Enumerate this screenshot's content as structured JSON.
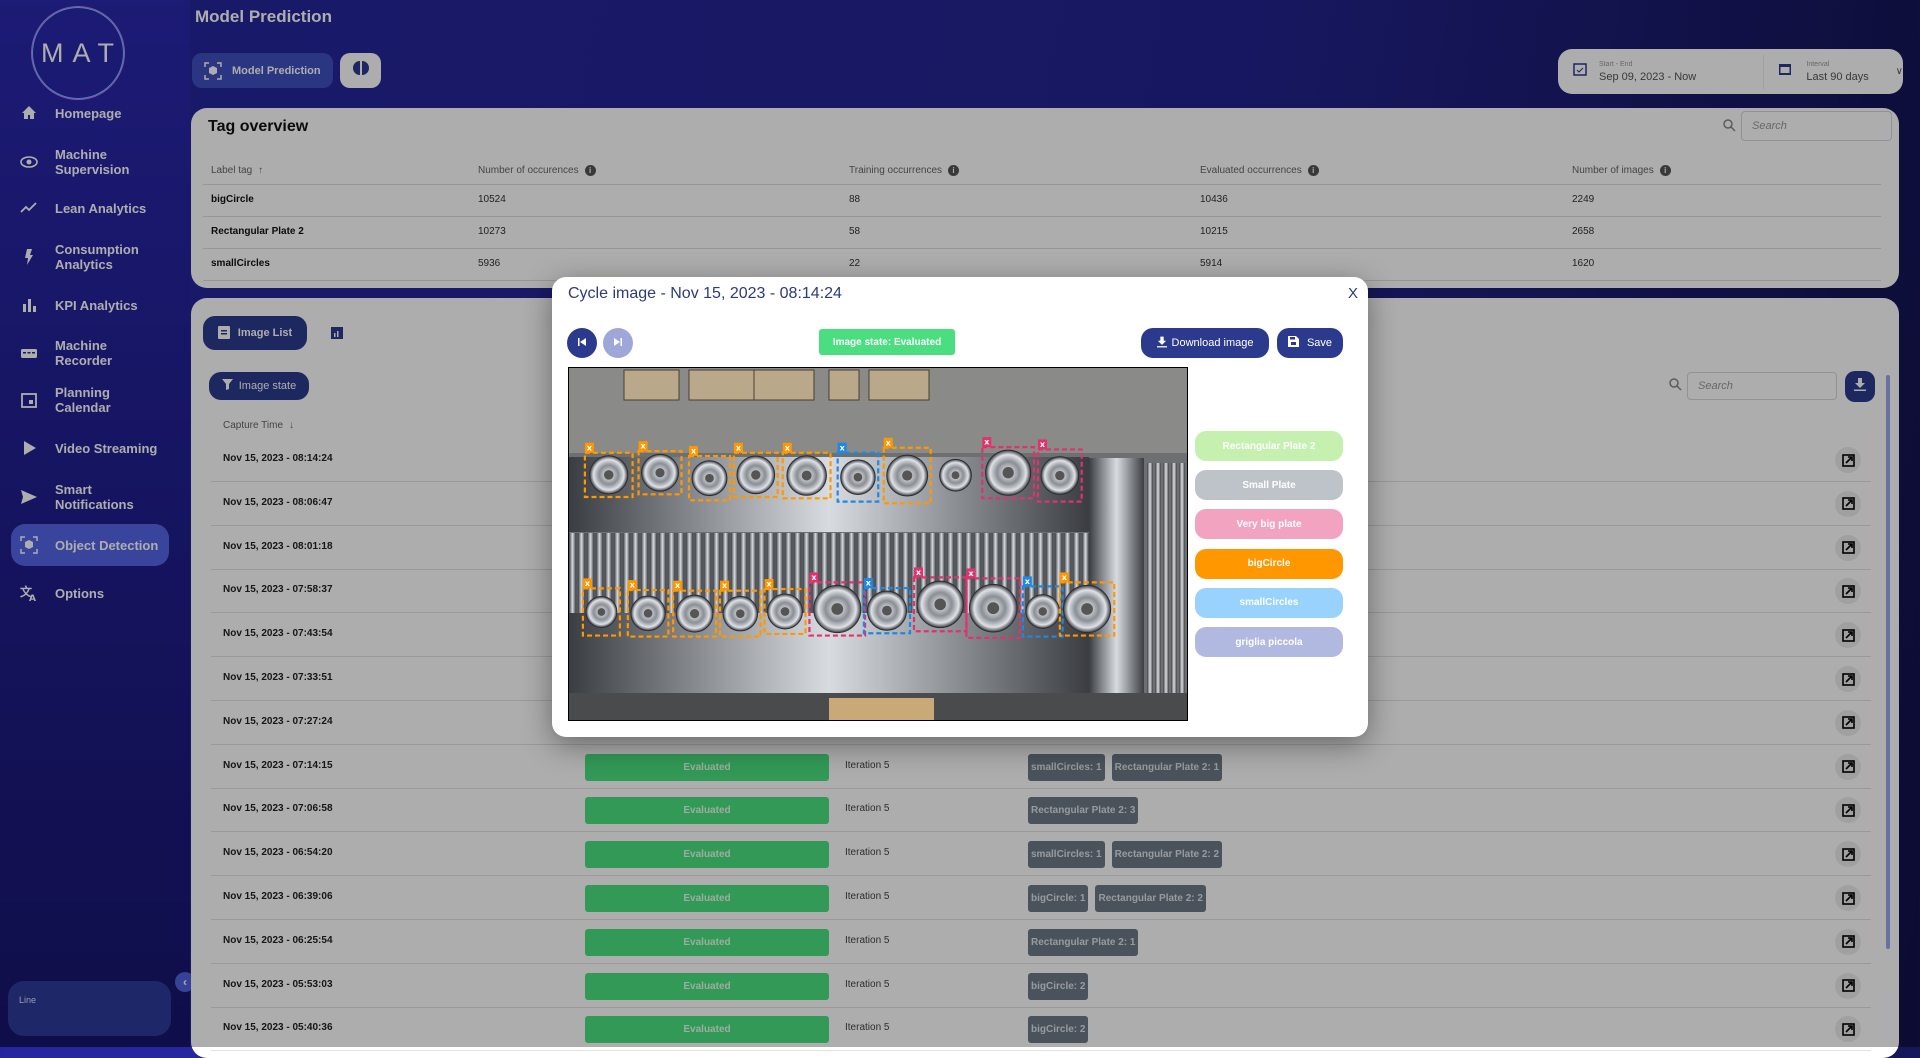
{
  "sidebar": {
    "logo": "MAT",
    "items": [
      {
        "label": "Homepage",
        "icon": "home-icon"
      },
      {
        "label": "Machine Supervision",
        "icon": "eye-icon"
      },
      {
        "label": "Lean Analytics",
        "icon": "trend-icon"
      },
      {
        "label": "Consumption Analytics",
        "icon": "bolt-icon"
      },
      {
        "label": "KPI Analytics",
        "icon": "bar-chart-icon"
      },
      {
        "label": "Machine Recorder",
        "icon": "recorder-icon"
      },
      {
        "label": "Planning Calendar",
        "icon": "calendar-icon"
      },
      {
        "label": "Video Streaming",
        "icon": "play-icon"
      },
      {
        "label": "Smart Notifications",
        "icon": "send-icon"
      },
      {
        "label": "Object Detection",
        "icon": "object-detection-icon",
        "active": true
      },
      {
        "label": "Options",
        "icon": "translate-icon"
      }
    ],
    "line_label": "Line"
  },
  "header": {
    "title": "Model Prediction",
    "tab_model_prediction": "Model Prediction",
    "date": {
      "start_end_label": "Start - End",
      "start_end_value": "Sep 09, 2023 - Now",
      "interval_label": "Interval",
      "interval_value": "Last 90 days"
    }
  },
  "tag_overview": {
    "title": "Tag overview",
    "search_placeholder": "Search",
    "columns": [
      "Label tag",
      "Number of occurences",
      "Training occurrences",
      "Evaluated occurrences",
      "Number of images"
    ],
    "rows": [
      [
        "bigCircle",
        "10524",
        "88",
        "10436",
        "2249"
      ],
      [
        "Rectangular Plate 2",
        "10273",
        "58",
        "10215",
        "2658"
      ],
      [
        "smallCircles",
        "5936",
        "22",
        "5914",
        "1620"
      ]
    ]
  },
  "image_list": {
    "tab_label": "Image List",
    "filter_label": "Image state",
    "search_placeholder": "Search",
    "column_capture_time": "Capture Time",
    "rows": [
      {
        "time": "Nov 15, 2023 - 08:14:24"
      },
      {
        "time": "Nov 15, 2023 - 08:06:47"
      },
      {
        "time": "Nov 15, 2023 - 08:01:18"
      },
      {
        "time": "Nov 15, 2023 - 07:58:37"
      },
      {
        "time": "Nov 15, 2023 - 07:43:54"
      },
      {
        "time": "Nov 15, 2023 - 07:33:51"
      },
      {
        "time": "Nov 15, 2023 - 07:27:24"
      },
      {
        "time": "Nov 15, 2023 - 07:14:15",
        "state": "Evaluated",
        "iteration": "Iteration 5",
        "tags": [
          "smallCircles: 1",
          "Rectangular Plate 2: 1"
        ]
      },
      {
        "time": "Nov 15, 2023 - 07:06:58",
        "state": "Evaluated",
        "iteration": "Iteration 5",
        "tags": [
          "Rectangular Plate 2: 3"
        ]
      },
      {
        "time": "Nov 15, 2023 - 06:54:20",
        "state": "Evaluated",
        "iteration": "Iteration 5",
        "tags": [
          "smallCircles: 1",
          "Rectangular Plate 2: 2"
        ]
      },
      {
        "time": "Nov 15, 2023 - 06:39:06",
        "state": "Evaluated",
        "iteration": "Iteration 5",
        "tags": [
          "bigCircle: 1",
          "Rectangular Plate 2: 2"
        ]
      },
      {
        "time": "Nov 15, 2023 - 06:25:54",
        "state": "Evaluated",
        "iteration": "Iteration 5",
        "tags": [
          "Rectangular Plate 2: 1"
        ]
      },
      {
        "time": "Nov 15, 2023 - 05:53:03",
        "state": "Evaluated",
        "iteration": "Iteration 5",
        "tags": [
          "bigCircle: 2"
        ]
      },
      {
        "time": "Nov 15, 2023 - 05:40:36",
        "state": "Evaluated",
        "iteration": "Iteration 5",
        "tags": [
          "bigCircle: 2"
        ]
      }
    ]
  },
  "modal": {
    "title": "Cycle image - Nov 15, 2023 - 08:14:24",
    "close": "X",
    "image_state": "Image state:  Evaluated",
    "download_label": "Download image",
    "save_label": "Save",
    "tags": [
      {
        "label": "Rectangular Plate 2",
        "color": "#c6f0b0"
      },
      {
        "label": "Small Plate",
        "color": "#bdc3c8"
      },
      {
        "label": "Very big plate",
        "color": "#f2a3bf"
      },
      {
        "label": "bigCircle",
        "color": "#ff9800"
      },
      {
        "label": "smallCircles",
        "color": "#99d2fc"
      },
      {
        "label": "griglia piccola",
        "color": "#b1b9e0"
      }
    ],
    "box_colors": {
      "bigCircle": "#ff9800",
      "smallCircles": "#1e88e5",
      "Very big plate": "#e0336e"
    }
  },
  "colors": {
    "accent": "#2c3a8e",
    "evaluated": "#4be27f",
    "active_nav": "#5566e6"
  }
}
